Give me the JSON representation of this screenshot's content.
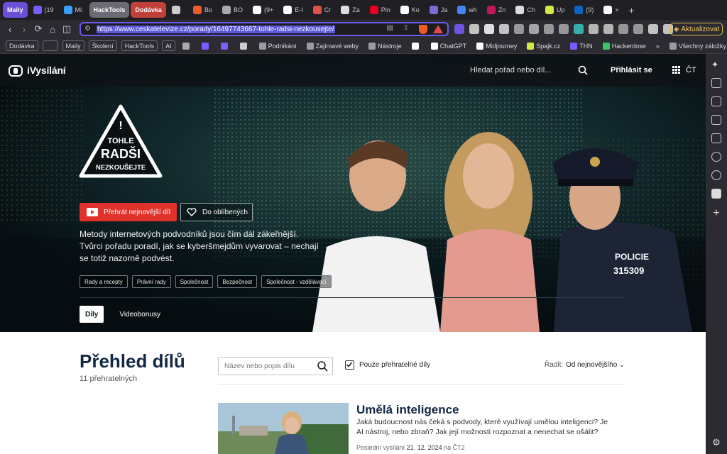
{
  "browser": {
    "tabs": [
      {
        "label": "Maily",
        "color": "#6b4fd8",
        "group": true
      },
      {
        "label": "(19",
        "color": "#7b5cff"
      },
      {
        "label": "Mi:",
        "color": "#3aa0ff"
      },
      {
        "label": "HackTools",
        "color": "#6b6b75",
        "group": true
      },
      {
        "label": "Dodávka",
        "color": "#c0403a",
        "group": true
      },
      {
        "label": "",
        "color": "#cccccc"
      },
      {
        "label": "Bo",
        "color": "#e85d2a"
      },
      {
        "label": "BO",
        "color": "#aaaaaa"
      },
      {
        "label": "(9+",
        "color": "#ffffff"
      },
      {
        "label": "E-I",
        "color": "#ffffff"
      },
      {
        "label": "Cr",
        "color": "#e0504a"
      },
      {
        "label": "Za",
        "color": "#dddddd"
      },
      {
        "label": "Pin",
        "color": "#e60023"
      },
      {
        "label": "Ko",
        "color": "#ffffff"
      },
      {
        "label": "Ja",
        "color": "#7b6bd8"
      },
      {
        "label": "wh",
        "color": "#4285f4"
      },
      {
        "label": "Zn",
        "color": "#c2185b"
      },
      {
        "label": "Ch",
        "color": "#dddddd"
      },
      {
        "label": "Up",
        "color": "#d6e94a"
      },
      {
        "label": "(9)",
        "color": "#0a66c2"
      },
      {
        "label": "×",
        "color": "#ffffff"
      }
    ],
    "new_tab_label": "+",
    "url": "https://www.ceskatelevize.cz/porady/16497743667-tohle-radsi-nezkousejte/",
    "update_label": "Aktualizovat",
    "bookmarks": [
      {
        "label": "Dodávka",
        "color": "#c0403a",
        "boxed": true
      },
      {
        "label": "",
        "color": "#dddddd",
        "boxed": true
      },
      {
        "label": "Maily",
        "color": "#6b4fd8",
        "boxed": true
      },
      {
        "label": "Školení",
        "color": "#3a8fd8",
        "boxed": true
      },
      {
        "label": "HackTools",
        "color": "#6b6b75",
        "boxed": true
      },
      {
        "label": "AI",
        "color": "#c99a2e",
        "boxed": true
      },
      {
        "label": "",
        "color": "#aaaaaa"
      },
      {
        "label": "",
        "color": "#7b5cff"
      },
      {
        "label": "",
        "color": "#7b5cff"
      },
      {
        "label": "",
        "color": "#cccccc"
      },
      {
        "label": "Podnikání",
        "color": "#9a9aa5"
      },
      {
        "label": "Zajímavé weby",
        "color": "#9a9aa5"
      },
      {
        "label": "Nástroje",
        "color": "#9a9aa5"
      },
      {
        "label": "",
        "color": "#ffffff"
      },
      {
        "label": "ChatGPT",
        "color": "#ffffff"
      },
      {
        "label": "Midjourney",
        "color": "#ffffff"
      },
      {
        "label": "Spajk.cz",
        "color": "#d6e94a"
      },
      {
        "label": "THN",
        "color": "#7b5cff"
      },
      {
        "label": "Hackerdose",
        "color": "#3ac46a"
      },
      {
        "label": "»",
        "color": ""
      },
      {
        "label": "Všechny záložky",
        "color": "#9a9aa5"
      }
    ]
  },
  "site": {
    "logo_text": "iVysílání",
    "search_placeholder": "Hledat pořad nebo díl...",
    "sign_in": "Přihlásit se",
    "ct_label": "ČT"
  },
  "hero": {
    "show_logo_lines": [
      "TOHLE",
      "RADŠI",
      "NEZKOUŠEJTE"
    ],
    "show_logo_mark": "!",
    "play_button": "Přehrát nejnovější díl",
    "favorite_button": "Do oblíbených",
    "description": "Metody internetových podvodníků jsou čím dál zákeřnější. Tvůrci pořadu poradí, jak se kyberšmejdům vyvarovat – nechají se totiž nazorně podvést.",
    "tags": [
      "Rady a recepty",
      "Právní rady",
      "Společnost",
      "Bezpečnost",
      "Společnost - vzdělávací"
    ],
    "tabs": [
      {
        "label": "Díly",
        "active": true
      },
      {
        "label": "Videobonusy",
        "active": false
      }
    ],
    "police_text": "POLICIE",
    "police_number": "315309"
  },
  "overview": {
    "title": "Přehled dílů",
    "count": "11 přehratelných",
    "filter_placeholder": "Název nebo popis dílu",
    "checkbox_label": "Pouze přehratelné díly",
    "checkbox_checked": true,
    "sort_label": "Řadit:",
    "sort_value": "Od nejnovějšího"
  },
  "episode": {
    "title": "Umělá inteligence",
    "description": "Jaká budoucnost nás čeká s podvody, které využívají umělou inteligenci? Je AI nástroj, nebo zbraň? Jak její možnosti rozpoznat a nenechat se ošálit?",
    "meta_prefix": "Poslední vysílání",
    "meta_date": "21. 12. 2024",
    "meta_on": "na",
    "meta_channel": "ČT2"
  }
}
